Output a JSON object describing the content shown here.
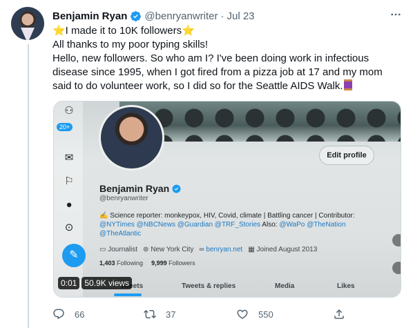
{
  "tweet": {
    "author_name": "Benjamin Ryan",
    "author_handle": "@benryanwriter",
    "separator": "·",
    "date": "Jul 23",
    "lines": [
      "⭐I made it to 10K followers⭐",
      "All thanks to my poor typing skills!",
      "Hello, new followers. So who am I? I've been doing work in infectious",
      "disease since 1995, when I got fired from a pizza job at 17 and my mom",
      "said to do volunteer work, so I did so for the Seattle AIDS Walk."
    ]
  },
  "media": {
    "notification_badge": "20+",
    "profile": {
      "name": "Benjamin Ryan",
      "handle": "@benryanwriter",
      "edit_button": "Edit profile",
      "bio_text": "Science reporter: monkeypox, HIV, Covid, climate | Battling cancer | Contributor:",
      "bio_links_1": "@NYTimes @NBCNews @Guardian @TRF_Stories",
      "bio_also": "Also:",
      "bio_links_2": "@WaPo @TheNation",
      "bio_links_3": "@TheAtlantic",
      "occupation": "Journalist",
      "location": "New York City",
      "website": "benryan.net",
      "joined": "Joined August 2013",
      "following_count": "1,403",
      "following_label": "Following",
      "followers_count": "9,999",
      "followers_label": "Followers",
      "tabs": [
        "Tweets",
        "Tweets & replies",
        "Media",
        "Likes"
      ]
    },
    "video_time": "0:01",
    "video_views": "50.9K views"
  },
  "actions": {
    "replies": "66",
    "retweets": "37",
    "likes": "550"
  },
  "colors": {
    "accent": "#1d9bf0",
    "text_primary": "#0f1419",
    "text_secondary": "#536471"
  }
}
